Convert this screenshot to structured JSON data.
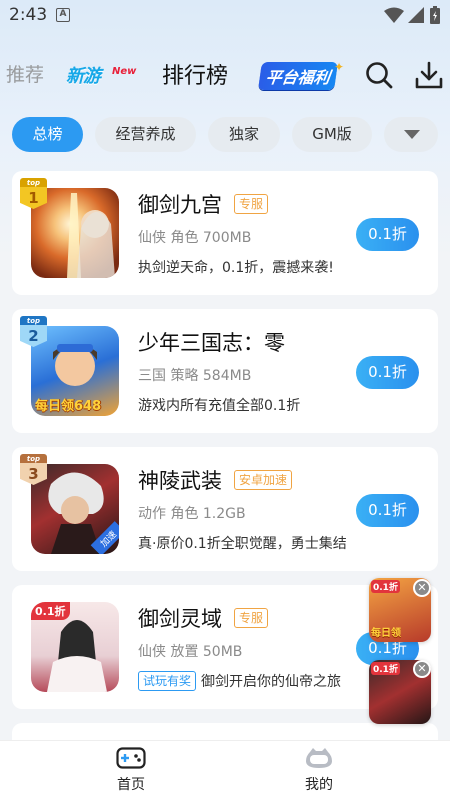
{
  "status": {
    "time": "2:43",
    "notif": "A"
  },
  "nav": {
    "recommend": "推荐",
    "new": "新游",
    "new_badge": "New",
    "rank": "排行榜",
    "welfare": "平台福利"
  },
  "chips": [
    {
      "label": "总榜",
      "active": true
    },
    {
      "label": "经营养成",
      "active": false
    },
    {
      "label": "独家",
      "active": false
    },
    {
      "label": "GM版",
      "active": false
    }
  ],
  "games": [
    {
      "rank_top": "top",
      "rank": "1",
      "title": "御剑九宫",
      "tag": "专服",
      "meta": "仙侠 角色 700MB",
      "desc": "执剑逆天命，0.1折，震撼来袭!",
      "button": "0.1折",
      "icon_text": ""
    },
    {
      "rank_top": "top",
      "rank": "2",
      "title": "少年三国志：零",
      "tag": "",
      "meta": "三国 策略 584MB",
      "desc": "游戏内所有充值全部0.1折",
      "button": "0.1折",
      "icon_text": "每日领648"
    },
    {
      "rank_top": "top",
      "rank": "3",
      "title": "神陵武装",
      "tag": "安卓加速",
      "meta": "动作 角色 1.2GB",
      "desc": "真·原价0.1折全职觉醒，勇士集结",
      "button": "0.1折",
      "icon_text": "加速"
    },
    {
      "rank_top": "",
      "rank": "",
      "title": "御剑灵域",
      "tag": "专服",
      "meta": "仙侠 放置 50MB",
      "desc": "御剑开启你的仙帝之旅",
      "trial": "试玩有奖",
      "button": "0.1折",
      "icon_text": "0.1折"
    }
  ],
  "float_ads": [
    {
      "badge": "0.1折",
      "caption": "每日领"
    },
    {
      "badge": "0.1折",
      "caption": ""
    }
  ],
  "bottom_nav": {
    "home": "首页",
    "mine": "我的"
  },
  "colors": {
    "accent": "#2c9af2",
    "tag_orange": "#f0a443"
  }
}
